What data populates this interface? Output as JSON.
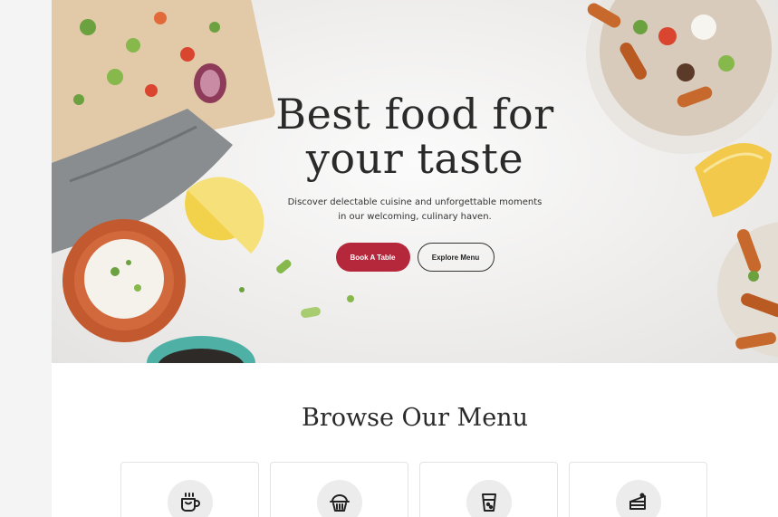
{
  "hero": {
    "title_line1": "Best food for",
    "title_line2": "your taste",
    "subtitle_line1": "Discover delectable cuisine and unforgettable moments",
    "subtitle_line2": "in our welcoming, culinary haven.",
    "primary_button": "Book A Table",
    "secondary_button": "Explore Menu"
  },
  "menu": {
    "title": "Browse Our Menu",
    "categories": [
      {
        "icon": "coffee-mug-icon"
      },
      {
        "icon": "dessert-bowl-icon"
      },
      {
        "icon": "drink-cup-icon"
      },
      {
        "icon": "cake-slice-icon"
      }
    ]
  },
  "colors": {
    "accent": "#b5283b",
    "heading": "#2a2a2a",
    "icon_bg": "#ececec"
  }
}
